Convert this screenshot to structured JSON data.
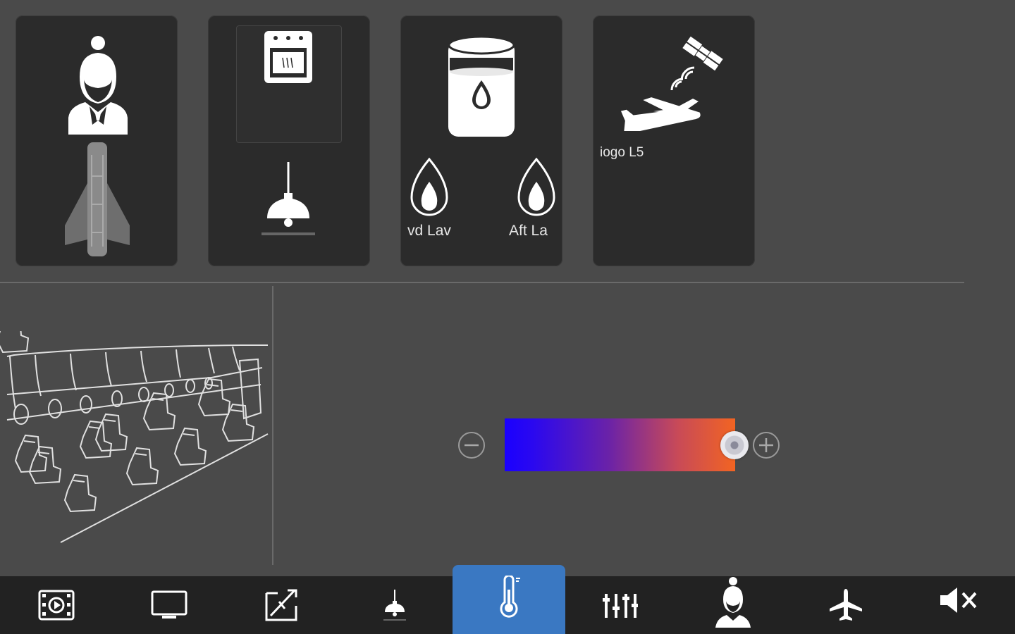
{
  "tiles": [
    {
      "name": "attendant-tile",
      "icon": "flight-attendant-icon",
      "sub_icon": "aircraft-topview-icon"
    },
    {
      "name": "galley-tile",
      "icon": "oven-icon",
      "sub_icon": "pendant-lamp-icon"
    },
    {
      "name": "water-tile",
      "icon": "water-tank-icon",
      "labels": [
        "vd Lav",
        "Aft La"
      ],
      "sub_icon": "flame-icon"
    },
    {
      "name": "satcom-tile",
      "icon": "satellite-aircraft-icon",
      "label": "iogo L5"
    }
  ],
  "temperature": {
    "level": 1.0,
    "minus_icon": "minus-circle-icon",
    "plus_icon": "plus-circle-icon",
    "colors": {
      "cold": "#1a00ff",
      "hot": "#f26422"
    }
  },
  "nav": {
    "items": [
      {
        "id": "media",
        "icon": "film-play-icon"
      },
      {
        "id": "monitor",
        "icon": "monitor-icon"
      },
      {
        "id": "map",
        "icon": "flight-map-icon"
      },
      {
        "id": "lighting",
        "icon": "pendant-lamp-icon"
      },
      {
        "id": "temperature",
        "icon": "thermometer-icon",
        "active": true
      },
      {
        "id": "audio",
        "icon": "sliders-icon"
      },
      {
        "id": "attendant",
        "icon": "flight-attendant-icon"
      },
      {
        "id": "flight",
        "icon": "airplane-icon"
      },
      {
        "id": "mute",
        "icon": "speaker-mute-icon"
      }
    ],
    "active_color": "#3a78c2"
  }
}
